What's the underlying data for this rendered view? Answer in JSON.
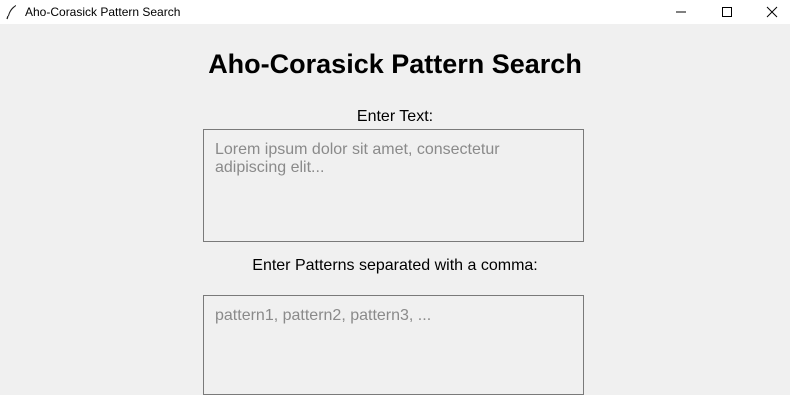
{
  "window": {
    "title": "Aho-Corasick Pattern Search",
    "app_icon": "feather-icon",
    "controls": [
      "minimize-icon",
      "maximize-icon",
      "close-icon"
    ]
  },
  "main": {
    "heading": "Aho-Corasick Pattern Search",
    "text_label": "Enter Text:",
    "text_placeholder": "Lorem ipsum dolor sit amet, consectetur adipiscing elit...",
    "patterns_label": "Enter Patterns separated with a comma:",
    "patterns_placeholder": "pattern1, pattern2, pattern3, ..."
  }
}
